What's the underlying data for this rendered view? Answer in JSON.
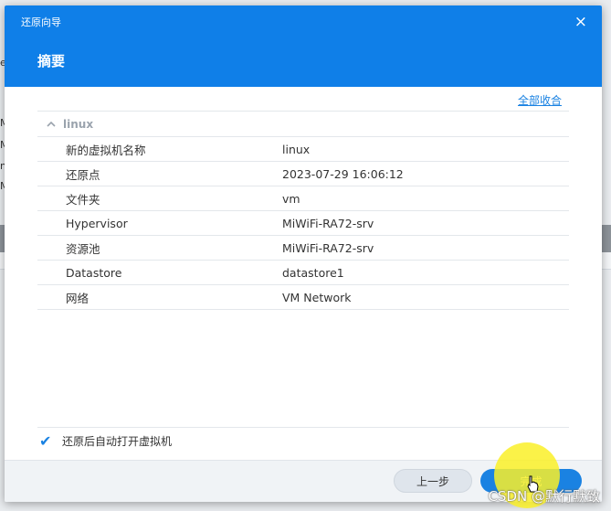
{
  "dialog": {
    "title": "还原向导",
    "heading": "摘要",
    "close_icon": "×",
    "collapse_all": "全部收合"
  },
  "summary": {
    "group_name": "linux",
    "chevron_icon": "^",
    "rows": [
      {
        "key": "新的虚拟机名称",
        "value": "linux"
      },
      {
        "key": "还原点",
        "value": "2023-07-29 16:06:12"
      },
      {
        "key": "文件夹",
        "value": "vm"
      },
      {
        "key": "Hypervisor",
        "value": "MiWiFi-RA72-srv"
      },
      {
        "key": "资源池",
        "value": "MiWiFi-RA72-srv"
      },
      {
        "key": "Datastore",
        "value": "datastore1"
      },
      {
        "key": "网络",
        "value": "VM Network"
      }
    ]
  },
  "options": {
    "power_on_label": "还原后自动打开虚拟机",
    "power_on_checked": true,
    "check_icon": "✔"
  },
  "footer": {
    "prev_label": "上一步",
    "finish_label": "完成"
  },
  "background": {
    "left_letters": [
      "e",
      "M",
      "M",
      "n",
      "M"
    ]
  },
  "watermark": "CSDN @默行默致",
  "colors": {
    "header": "#0f7fe8",
    "accent": "#1a82e2"
  }
}
